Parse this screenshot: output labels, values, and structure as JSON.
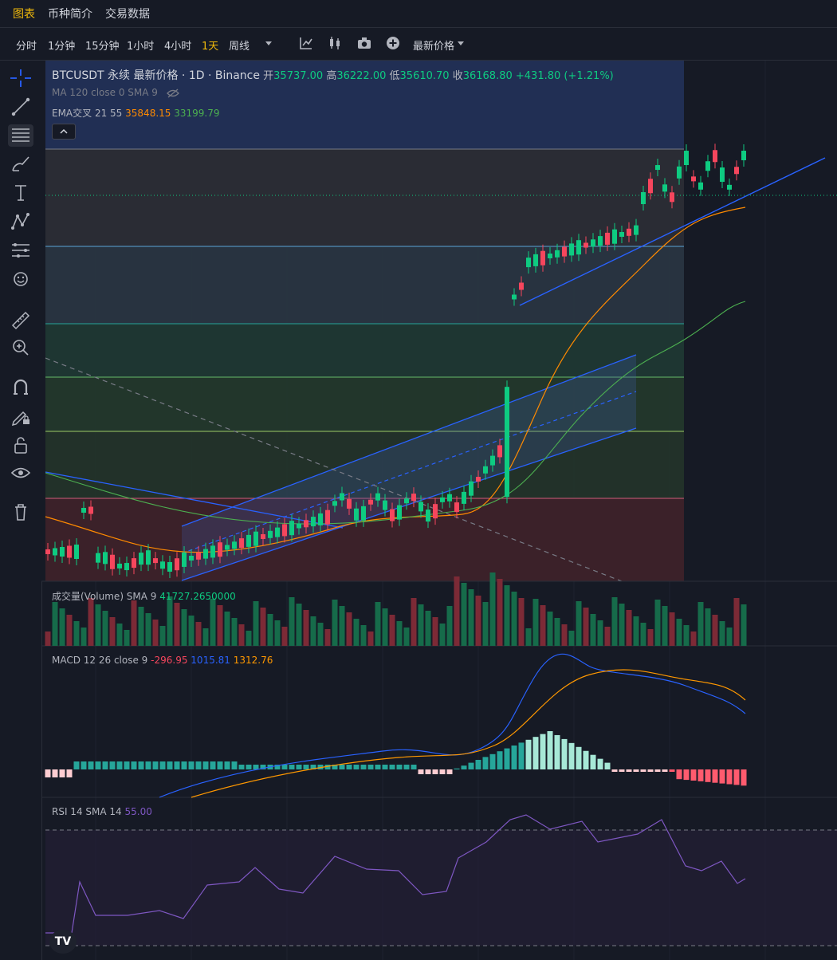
{
  "nav": {
    "tabs": [
      "图表",
      "币种简介",
      "交易数据"
    ],
    "active": 0
  },
  "timeframes": {
    "items": [
      "分时",
      "1分钟",
      "15分钟",
      "1小时",
      "4小时",
      "1天",
      "周线"
    ],
    "active": 5
  },
  "price_source": "最新价格",
  "icons": {
    "toolbar": [
      "dropdown-caret-icon",
      "indicators-icon",
      "candle-type-icon",
      "camera-icon",
      "add-plus-icon"
    ],
    "left": [
      "crosshair-icon",
      "trendline-icon",
      "fib-retracement-icon",
      "brush-icon",
      "text-icon",
      "pattern-icon",
      "ruler-lines-icon",
      "emoji-icon",
      "measure-icon",
      "zoom-in-icon",
      "magnet-icon",
      "lock-drawing-icon",
      "unlock-icon",
      "eye-icon",
      "trash-icon"
    ]
  },
  "legend": {
    "symbol": "BTCUSDT 永续 最新价格 · 1D · Binance",
    "open_label": "开",
    "open": "35737.00",
    "high_label": "高",
    "high": "36222.00",
    "low_label": "低",
    "low": "35610.70",
    "close_label": "收",
    "close": "36168.80",
    "change": "+431.80 (+1.21%)",
    "ma_text": "MA 120 close 0 SMA 9",
    "ema_label": "EMA交叉 21 55",
    "ema_fast": "35848.15",
    "ema_slow": "33199.79"
  },
  "volume": {
    "label": "成交量(Volume) SMA 9",
    "value": "41727.2650000"
  },
  "macd": {
    "label": "MACD 12 26 close 9",
    "hist": "-296.95",
    "macd": "1015.81",
    "signal": "1312.76"
  },
  "rsi": {
    "label": "RSI 14 SMA 14",
    "value": "55.00"
  },
  "logo": "TV",
  "colors": {
    "up": "#0ecb81",
    "down": "#f6465d",
    "accent": "#f0b90b",
    "ema_fast": "#ff8a00",
    "ema_slow": "#4caf50",
    "macd": "#2962ff",
    "signal": "#ff9800",
    "rsi": "#7e57c2"
  }
}
